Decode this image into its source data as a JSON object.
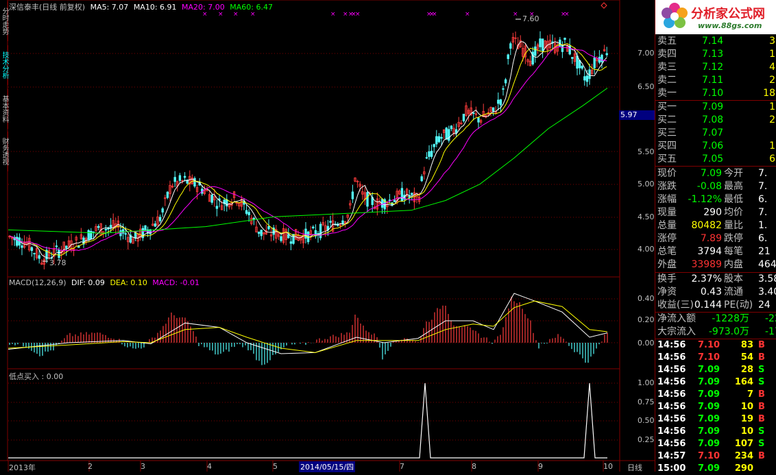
{
  "left_tabs": [
    "分时走势",
    "技术分析",
    "基本资料",
    "财务透视"
  ],
  "header": {
    "title": "深信泰丰(日线 前复权)",
    "ma5": "MA5: 7.07",
    "ma10": "MA10: 6.91",
    "ma20": "MA20: 7.00",
    "ma60": "MA60: 6.47"
  },
  "price_axis": [
    "7.00",
    "6.50",
    "5.97",
    "5.50",
    "5.00",
    "4.50",
    "4.00"
  ],
  "price_marks": {
    "high": "7.60",
    "low": "3.78"
  },
  "macd": {
    "header": "MACD(12,26,9)",
    "dif": "DIF: 0.09",
    "dea": "DEA: 0.10",
    "macd": "MACD: -0.01",
    "axis": [
      "0.40",
      "0.20",
      "0.00"
    ]
  },
  "indicator": {
    "header": "低点买入 : 0.00",
    "axis": [
      "1.00",
      "0.75",
      "0.50",
      "0.25"
    ]
  },
  "time_axis": [
    "2013年",
    "2",
    "3",
    "4",
    "2014/05/15/四",
    "5",
    "7",
    "8",
    "9",
    "10"
  ],
  "period_label": "日线",
  "logo": {
    "name": "分析家公式网",
    "url": "www.88gs.com"
  },
  "asks": [
    {
      "label": "卖五",
      "price": "7.14",
      "vol": "3"
    },
    {
      "label": "卖四",
      "price": "7.13",
      "vol": "1"
    },
    {
      "label": "卖三",
      "price": "7.12",
      "vol": "4"
    },
    {
      "label": "卖二",
      "price": "7.11",
      "vol": "2"
    },
    {
      "label": "卖一",
      "price": "7.10",
      "vol": "18"
    }
  ],
  "bids": [
    {
      "label": "买一",
      "price": "7.09",
      "vol": "1"
    },
    {
      "label": "买二",
      "price": "7.08",
      "vol": "2"
    },
    {
      "label": "买三",
      "price": "7.07",
      "vol": ""
    },
    {
      "label": "买四",
      "price": "7.06",
      "vol": "1"
    },
    {
      "label": "买五",
      "price": "7.05",
      "vol": "6"
    }
  ],
  "quote": [
    {
      "l1": "现价",
      "v1": "7.09",
      "c1": "green",
      "l2": "今开",
      "v2": "7."
    },
    {
      "l1": "涨跌",
      "v1": "-0.08",
      "c1": "green",
      "l2": "最高",
      "v2": "7."
    },
    {
      "l1": "涨幅",
      "v1": "-1.12%",
      "c1": "green",
      "l2": "最低",
      "v2": "6."
    },
    {
      "l1": "现量",
      "v1": "290",
      "c1": "white",
      "l2": "均价",
      "v2": "7."
    },
    {
      "l1": "总量",
      "v1": "80482",
      "c1": "yellow",
      "l2": "量比",
      "v2": "1."
    },
    {
      "l1": "涨停",
      "v1": "7.89",
      "c1": "red",
      "l2": "跌停",
      "v2": "6."
    },
    {
      "l1": "总笔",
      "v1": "3794",
      "c1": "white",
      "l2": "每笔",
      "v2": "21"
    },
    {
      "l1": "外盘",
      "v1": "33989",
      "c1": "red",
      "l2": "内盘",
      "v2": "464"
    }
  ],
  "finance": [
    {
      "l1": "换手",
      "v1": "2.37%",
      "l2": "股本",
      "v2": "3.58"
    },
    {
      "l1": "净资",
      "v1": "0.43",
      "l2": "流通",
      "v2": "3.40"
    },
    {
      "l1": "收益(三)",
      "v1": "0.144",
      "l2": "PE(动)",
      "v2": "24"
    }
  ],
  "flows": [
    {
      "label": "净流入额",
      "value": "-1228万",
      "extra": "-22"
    },
    {
      "label": "大宗流入",
      "value": "-973.0万",
      "extra": "-17"
    }
  ],
  "ticks": [
    {
      "time": "14:56",
      "price": "7.10",
      "vol": "83",
      "side": "B"
    },
    {
      "time": "14:56",
      "price": "7.10",
      "vol": "54",
      "side": "B"
    },
    {
      "time": "14:56",
      "price": "7.09",
      "vol": "28",
      "side": "S"
    },
    {
      "time": "14:56",
      "price": "7.09",
      "vol": "164",
      "side": "S"
    },
    {
      "time": "14:56",
      "price": "7.09",
      "vol": "7",
      "side": "B"
    },
    {
      "time": "14:56",
      "price": "7.09",
      "vol": "10",
      "side": "B"
    },
    {
      "time": "14:56",
      "price": "7.09",
      "vol": "19",
      "side": "B"
    },
    {
      "time": "14:56",
      "price": "7.09",
      "vol": "10",
      "side": "S"
    },
    {
      "time": "14:56",
      "price": "7.09",
      "vol": "107",
      "side": "S"
    },
    {
      "time": "14:57",
      "price": "7.10",
      "vol": "234",
      "side": "B"
    },
    {
      "time": "15:00",
      "price": "7.09",
      "vol": "290",
      "side": ""
    }
  ],
  "colors": {
    "grid": "#800000",
    "up": "#ff3c3c",
    "down": "#54fcfc",
    "ma5": "#ffffff",
    "ma10": "#ffff00",
    "ma20": "#ff00ff",
    "ma60": "#00ff00"
  }
}
